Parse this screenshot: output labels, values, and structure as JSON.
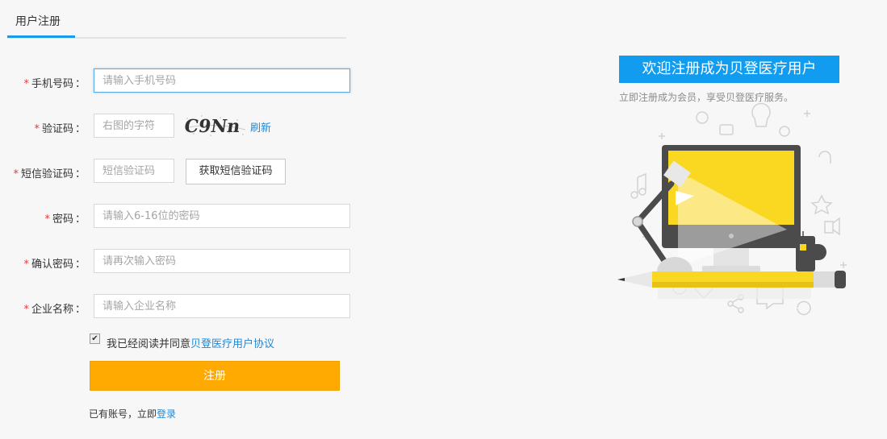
{
  "tab": {
    "active_label": "用户注册"
  },
  "form": {
    "phone": {
      "label": "手机号码",
      "placeholder": "请输入手机号码"
    },
    "captcha": {
      "label": "验证码",
      "placeholder": "右图的字符",
      "image_text": "C9Nn",
      "refresh_label": "刷新"
    },
    "sms": {
      "label": "短信验证码",
      "placeholder": "短信验证码",
      "button_label": "获取短信验证码"
    },
    "password": {
      "label": "密码",
      "placeholder": "请输入6-16位的密码"
    },
    "confirm": {
      "label": "确认密码",
      "placeholder": "请再次输入密码"
    },
    "company": {
      "label": "企业名称",
      "placeholder": "请输入企业名称"
    },
    "required_mark": "*",
    "colon": "："
  },
  "agreement": {
    "checked": true,
    "text": "我已经阅读并同意",
    "link_label": "贝登医疗用户协议"
  },
  "submit_label": "注册",
  "login": {
    "prefix": "已有账号，立即",
    "link_label": "登录"
  },
  "promo": {
    "title": "欢迎注册成为贝登医疗用户",
    "subtitle": "立即注册成为会员，享受贝登医疗服务。"
  },
  "colors": {
    "accent": "#119cf0",
    "button": "#ffaa00",
    "link": "#1e88d8",
    "required": "#e4393c",
    "illus_yellow": "#fad821"
  }
}
